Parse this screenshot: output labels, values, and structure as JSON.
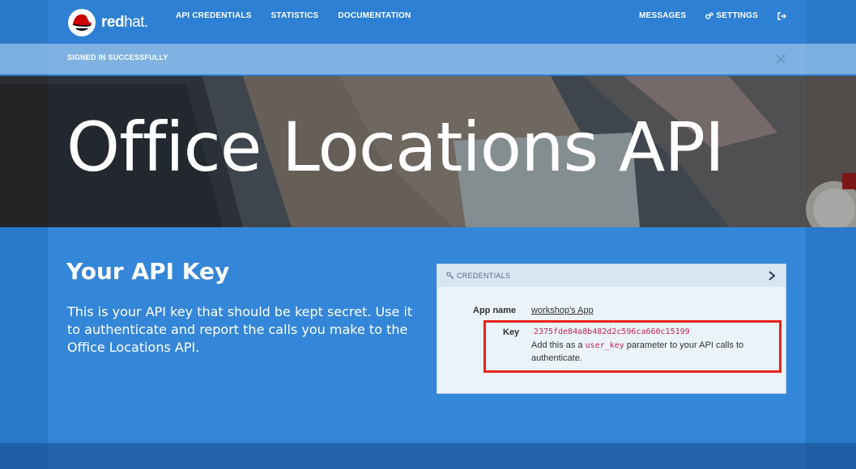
{
  "brand": {
    "name_bold": "red",
    "name_rest": "hat",
    "mark": "."
  },
  "nav": {
    "left": [
      {
        "label": "API CREDENTIALS"
      },
      {
        "label": "STATISTICS"
      },
      {
        "label": "DOCUMENTATION"
      }
    ],
    "right": {
      "messages": "MESSAGES",
      "settings": "SETTINGS",
      "signout_icon": "sign-out-icon"
    }
  },
  "alert": {
    "text": "SIGNED IN SUCCESSFULLY",
    "close_icon": "close-icon"
  },
  "hero": {
    "title": "Office Locations API"
  },
  "main": {
    "title": "Your API Key",
    "description": "This is your API key that should be kept secret. Use it to authenticate and report the calls you make to the Office Locations API."
  },
  "credentials": {
    "header": "CREDENTIALS",
    "app_name_label": "App name",
    "app_name_value": "workshop's App",
    "key_label": "Key",
    "key_value": "2375fde84a8b482d2c596ca660c15199",
    "hint_prefix": "Add this as a",
    "hint_code": "user_key",
    "hint_suffix": "parameter to your API calls to",
    "hint_line2": "authenticate."
  },
  "colors": {
    "accent": "#2d80d3",
    "highlight": "#e8231b",
    "code": "#c7254e"
  }
}
